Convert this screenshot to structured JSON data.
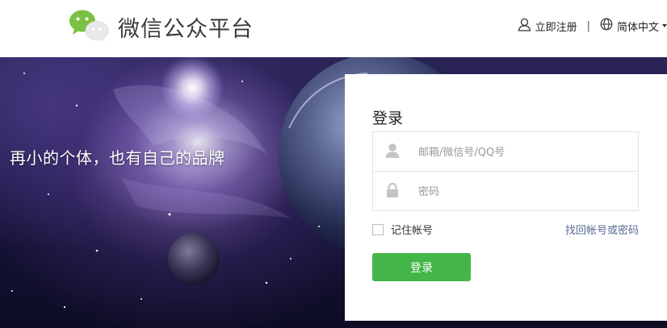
{
  "header": {
    "brand_title": "微信公众平台",
    "register_label": "立即注册",
    "separator": "|",
    "language_label": "简体中文"
  },
  "banner": {
    "slogan": "再小的个体，也有自己的品牌"
  },
  "login": {
    "title": "登录",
    "account_placeholder": "邮箱/微信号/QQ号",
    "password_placeholder": "密码",
    "remember_label": "记住帐号",
    "forgot_label": "找回帐号或密码",
    "submit_label": "登录"
  },
  "colors": {
    "accent_green": "#44b549",
    "link_blue": "#576b95",
    "logo_green": "#7bc043"
  },
  "icons": {
    "logo": "wechat-logo-icon",
    "register": "user-icon",
    "language": "globe-icon",
    "account": "person-icon",
    "password": "lock-icon"
  }
}
